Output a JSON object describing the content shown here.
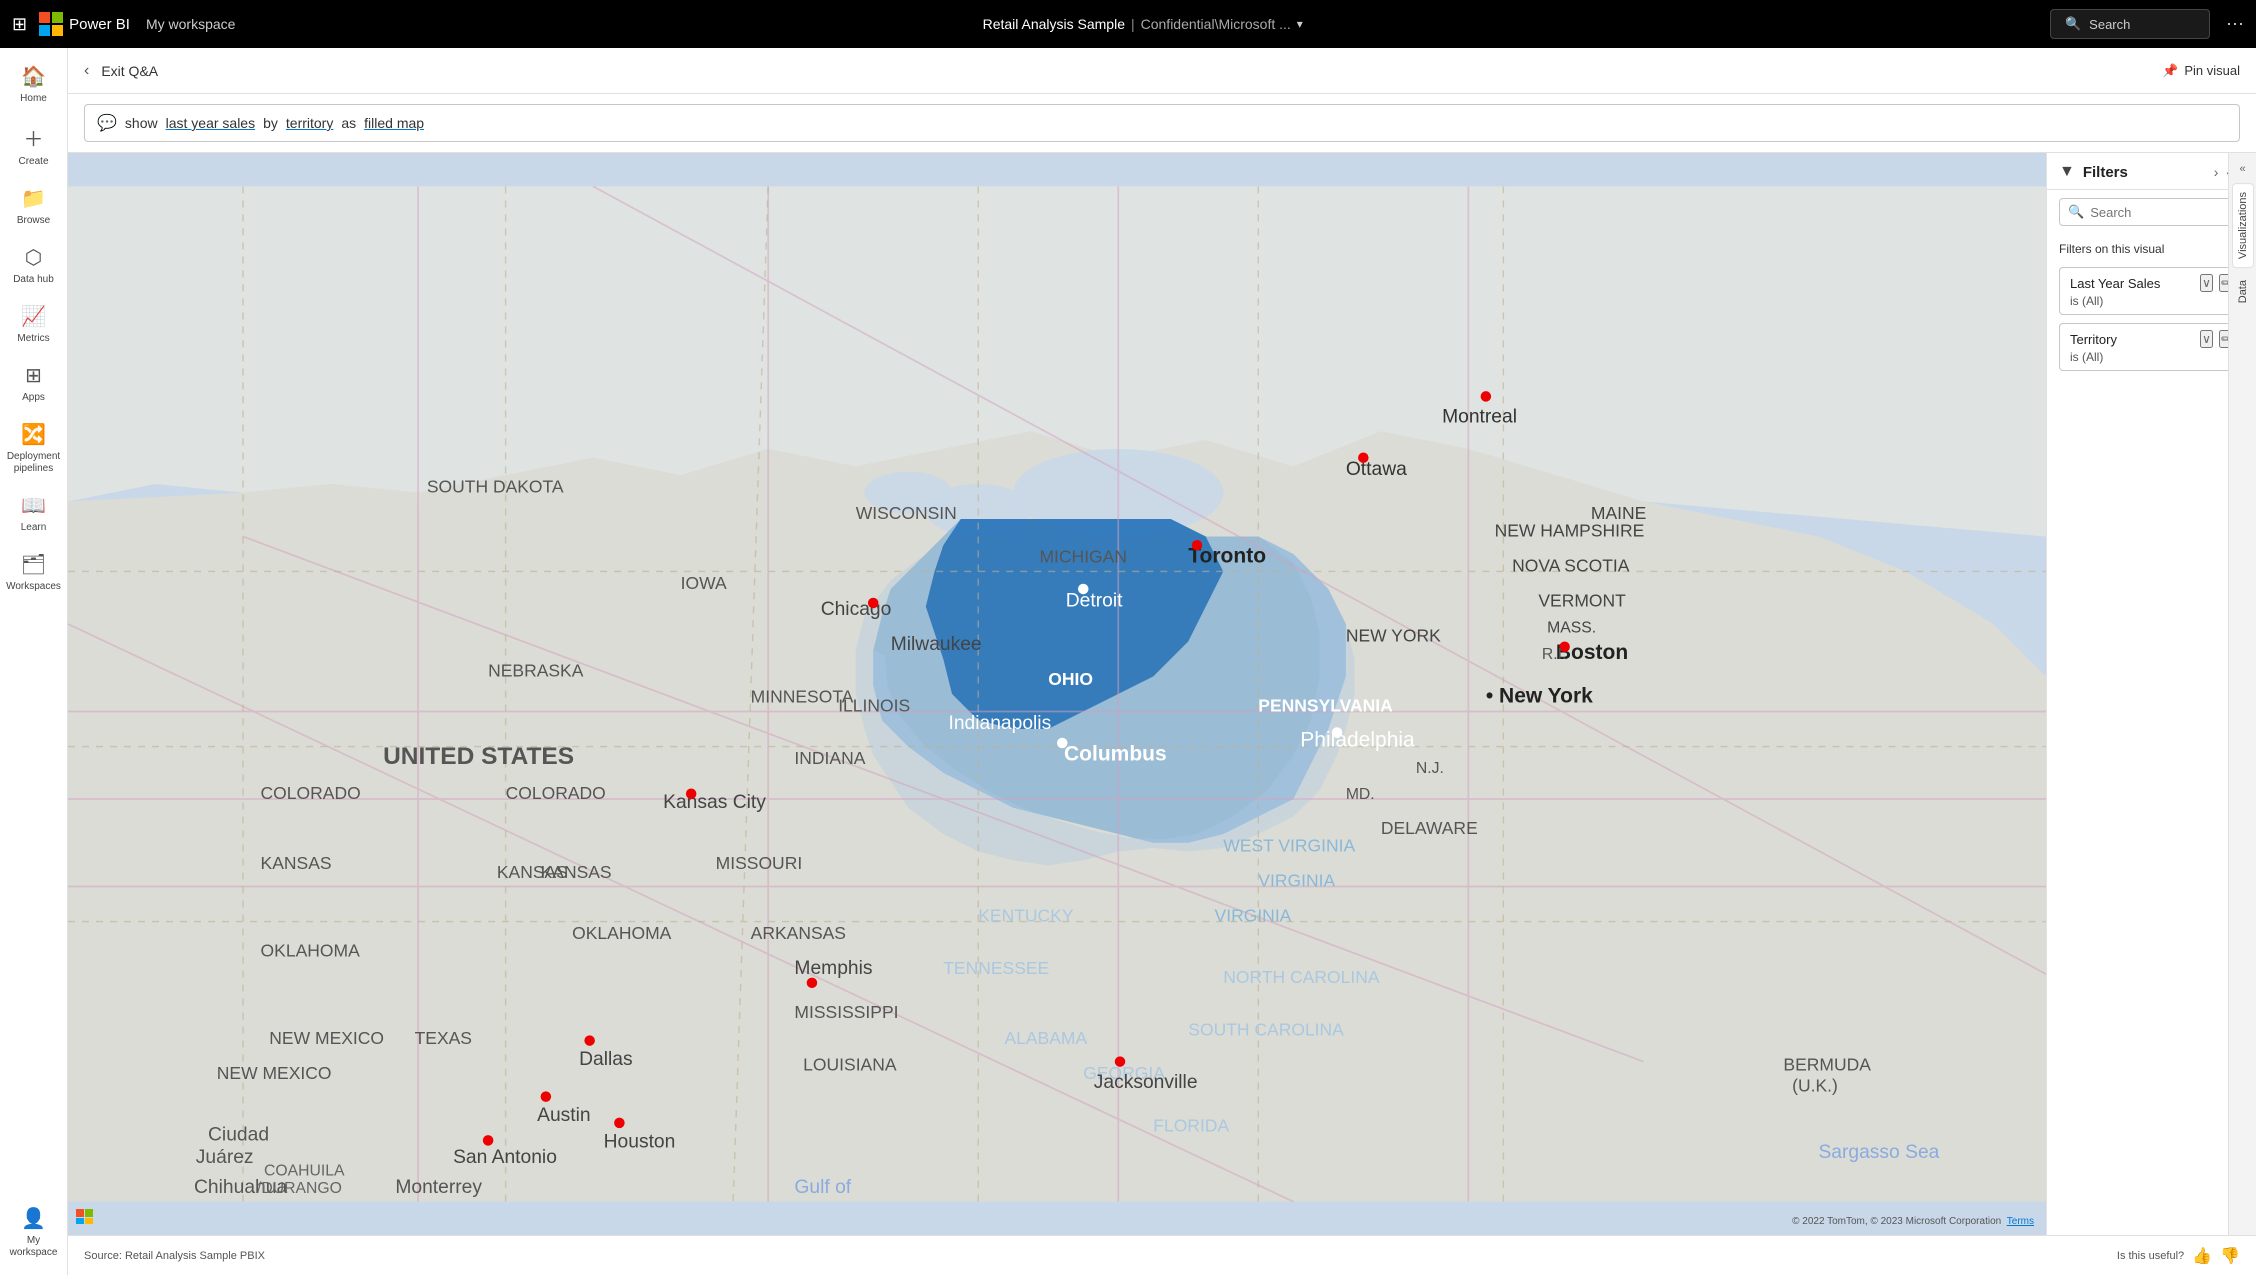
{
  "topbar": {
    "grid_icon": "⊞",
    "ms_logo_colors": [
      "#f25022",
      "#7fba00",
      "#00a4ef",
      "#ffb900"
    ],
    "app_name": "Power BI",
    "workspace_label": "My workspace",
    "report_title": "Retail Analysis Sample",
    "title_separator": "|",
    "report_subtitle": "Confidential\\Microsoft ...",
    "chevron": "▾",
    "search_placeholder": "Search",
    "search_icon": "🔍",
    "more_icon": "⋯"
  },
  "subheader": {
    "back_icon": "‹",
    "exit_qa_label": "Exit Q&A",
    "pin_icon": "📌",
    "pin_visual_label": "Pin visual"
  },
  "qa_bar": {
    "bubble_icon": "💬",
    "query_prefix": "show ",
    "query_highlighted1": "last year sales",
    "query_by": " by ",
    "query_highlighted2": "territory",
    "query_as": " as ",
    "query_highlighted3": "filled map"
  },
  "sidebar": {
    "items": [
      {
        "id": "home",
        "icon": "🏠",
        "label": "Home"
      },
      {
        "id": "create",
        "icon": "➕",
        "label": "Create"
      },
      {
        "id": "browse",
        "icon": "📁",
        "label": "Browse"
      },
      {
        "id": "data-hub",
        "icon": "🗄",
        "label": "Data hub"
      },
      {
        "id": "metrics",
        "icon": "📊",
        "label": "Metrics"
      },
      {
        "id": "apps",
        "icon": "⊞",
        "label": "Apps"
      },
      {
        "id": "deployment",
        "icon": "🚀",
        "label": "Deployment pipelines"
      },
      {
        "id": "learn",
        "icon": "📖",
        "label": "Learn"
      },
      {
        "id": "workspaces",
        "icon": "🗂",
        "label": "Workspaces"
      },
      {
        "id": "my-workspace",
        "icon": "👤",
        "label": "My workspace"
      }
    ]
  },
  "filters_panel": {
    "filter_icon": "▼",
    "title": "Filters",
    "expand_icon": "›",
    "collapse_left": "«",
    "collapse_right": "»",
    "search_placeholder": "Search",
    "search_icon": "🔍",
    "on_visual_label": "Filters on this visual",
    "more_icon": "⋯",
    "filters": [
      {
        "title": "Last Year Sales",
        "value": "is (All)",
        "chevron": "∨",
        "edit_icon": "✏"
      },
      {
        "title": "Territory",
        "value": "is (All)",
        "chevron": "∨",
        "edit_icon": "✏"
      }
    ]
  },
  "right_tabs": {
    "visualizations_label": "Visualizations",
    "data_label": "Data",
    "collapse_icon": "«"
  },
  "map": {
    "attribution": "© 2022 TomTom, © 2023 Microsoft Corporation",
    "terms_label": "Terms",
    "logo_text": "© Microsoft/Bing"
  },
  "bottom_bar": {
    "source_label": "Source: Retail Analysis Sample PBIX",
    "useful_label": "Is this useful?",
    "thumbs_up_icon": "👍",
    "thumbs_down_icon": "👎"
  }
}
